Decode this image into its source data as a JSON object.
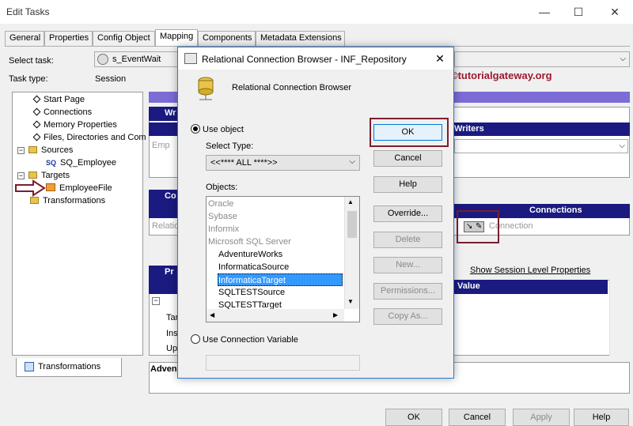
{
  "window": {
    "title": "Edit Tasks",
    "min_glyph": "—",
    "max_glyph": "☐",
    "close_glyph": "✕"
  },
  "tabs": [
    {
      "label": "General"
    },
    {
      "label": "Properties"
    },
    {
      "label": "Config Object"
    },
    {
      "label": "Mapping"
    },
    {
      "label": "Components"
    },
    {
      "label": "Metadata Extensions"
    }
  ],
  "active_tab": "Mapping",
  "select_task": {
    "label": "Select task:",
    "value": "s_EventWait"
  },
  "task_type": {
    "label": "Task type:",
    "value": "Session"
  },
  "watermark": "©tutorialgateway.org",
  "tree": {
    "items": [
      {
        "label": "Start Page"
      },
      {
        "label": "Connections"
      },
      {
        "label": "Memory Properties"
      },
      {
        "label": "Files, Directories and Com"
      },
      {
        "label": "Sources"
      },
      {
        "label": "SQ_Employee"
      },
      {
        "label": "Targets"
      },
      {
        "label": "EmployeeFile"
      },
      {
        "label": "Transformations"
      }
    ],
    "sq_icon": "SQ",
    "bottom_tab": "Transformations"
  },
  "right": {
    "writers_header": "Writers",
    "wr_label": "Wr",
    "emp_label": "Emp",
    "co_label": "Co",
    "relation_label": "Relatio",
    "connections_header": "Connections",
    "connection_value": "Connection",
    "show_session": "Show Session Level Properties",
    "pr_label": "Pr",
    "value_header": "Value",
    "rows": [
      {
        "label": "Tar"
      },
      {
        "label": "Ins"
      },
      {
        "label": "Up"
      }
    ],
    "adven_label": "Adven"
  },
  "bottom_buttons": [
    {
      "label": "OK"
    },
    {
      "label": "Cancel"
    },
    {
      "label": "Apply"
    },
    {
      "label": "Help"
    }
  ],
  "dialog": {
    "title": "Relational Connection Browser - INF_Repository",
    "header": "Relational Connection Browser",
    "use_object": "Use object",
    "select_type_label": "Select Type:",
    "select_type_value": "<<**** ALL ****>>",
    "objects_label": "Objects:",
    "objects": [
      {
        "label": "Oracle",
        "kind": "category"
      },
      {
        "label": "Sybase",
        "kind": "category"
      },
      {
        "label": "Informix",
        "kind": "category"
      },
      {
        "label": "Microsoft SQL Server",
        "kind": "category"
      },
      {
        "label": "AdventureWorks",
        "kind": "item"
      },
      {
        "label": "InformaticaSource",
        "kind": "item"
      },
      {
        "label": "InformaticaTarget",
        "kind": "item",
        "selected": true
      },
      {
        "label": "SQLTESTSource",
        "kind": "item"
      },
      {
        "label": "SQLTESTTarget",
        "kind": "item"
      }
    ],
    "use_conn_var": "Use Connection Variable",
    "buttons": [
      {
        "label": "OK",
        "enabled": true
      },
      {
        "label": "Cancel",
        "enabled": true
      },
      {
        "label": "Help",
        "enabled": true
      },
      {
        "label": "Override...",
        "enabled": true
      },
      {
        "label": "Delete",
        "enabled": false
      },
      {
        "label": "New...",
        "enabled": false
      },
      {
        "label": "Permissions...",
        "enabled": false
      },
      {
        "label": "Copy As...",
        "enabled": false
      }
    ]
  },
  "colors": {
    "purple": "#7b6cd6",
    "navy": "#1a1a80",
    "highlight": "#3399ff",
    "annotation_red": "#7b1e2e"
  }
}
